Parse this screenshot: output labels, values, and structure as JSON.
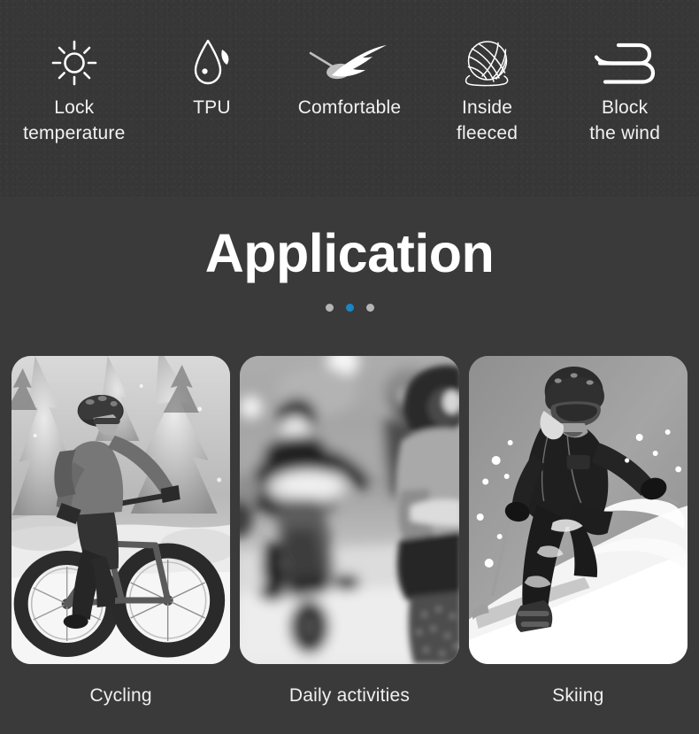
{
  "features": {
    "items": [
      {
        "icon": "sun-icon",
        "label": "Lock\ntemperature"
      },
      {
        "icon": "droplet-icon",
        "label": "TPU"
      },
      {
        "icon": "feather-icon",
        "label": "Comfortable"
      },
      {
        "icon": "yarn-ball-icon",
        "label": "Inside\nfleeced"
      },
      {
        "icon": "wind-icon",
        "label": "Block\nthe wind"
      }
    ]
  },
  "application": {
    "title": "Application",
    "carousel": {
      "dots": 3,
      "active_index": 1,
      "dot_color": "#b5b5b5",
      "active_dot_color": "#1b85c7"
    }
  },
  "cards": [
    {
      "caption": "Cycling",
      "image": "cyclist-fat-bike-snow-photo"
    },
    {
      "caption": "Daily activities",
      "image": "blurred-street-scooter-photo"
    },
    {
      "caption": "Skiing",
      "image": "skier-carving-snow-photo"
    }
  ],
  "colors": {
    "strip_background": "#373737",
    "page_background": "#3a3a3a",
    "text": "#f2f2f2",
    "accent": "#1b85c7"
  }
}
